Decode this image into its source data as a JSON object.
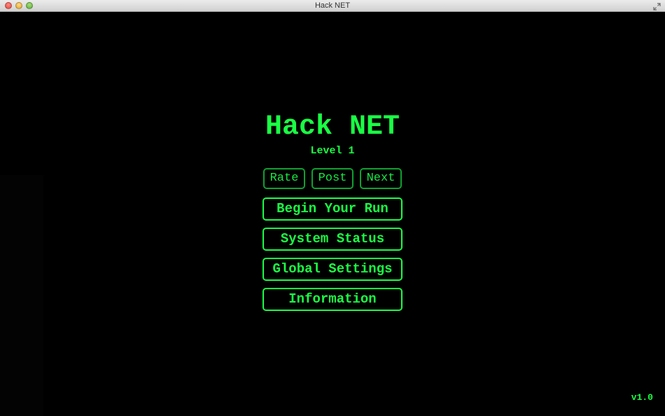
{
  "window": {
    "title": "Hack NET"
  },
  "game": {
    "title": "Hack NET",
    "level": "Level 1",
    "version": "v1.0"
  },
  "small_buttons": {
    "rate": "Rate",
    "post": "Post",
    "next": "Next"
  },
  "menu": {
    "begin": "Begin Your Run",
    "status": "System Status",
    "settings": "Global Settings",
    "information": "Information"
  },
  "colors": {
    "accent": "#19ff44",
    "accent_dim": "#0fa030",
    "background": "#000000"
  },
  "icons": {
    "close": "close-icon",
    "minimize": "minimize-icon",
    "zoom": "zoom-icon",
    "fullscreen": "fullscreen-icon"
  }
}
